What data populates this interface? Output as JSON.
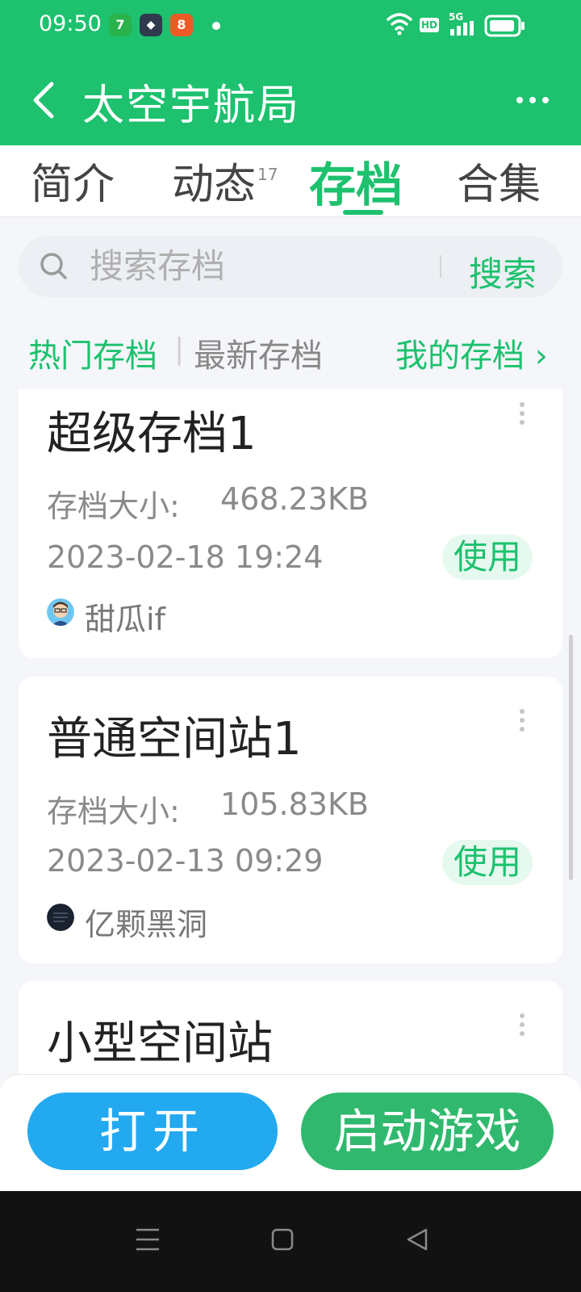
{
  "status_bar": {
    "time": "09:50",
    "apps": [
      {
        "icon": "green-app-icon",
        "glyph": "7",
        "color": "#29b34a"
      },
      {
        "icon": "dark-app-icon",
        "glyph": "◆",
        "color": "#2f3a4f"
      },
      {
        "icon": "orange-app-icon",
        "glyph": "8",
        "color": "#ee5a24"
      }
    ],
    "hd_label": "HD",
    "network_label": "5G"
  },
  "header": {
    "title": "太空宇航局",
    "back_icon": "back-arrow-icon",
    "more_icon": "more-dots-icon"
  },
  "tabs": [
    {
      "label": "简介",
      "badge": ""
    },
    {
      "label": "动态",
      "badge": "17"
    },
    {
      "label": "存档",
      "badge": "",
      "active": true
    },
    {
      "label": "合集",
      "badge": ""
    }
  ],
  "search": {
    "placeholder": "搜索存档",
    "button_label": "搜索"
  },
  "filters": {
    "hot": "热门存档",
    "separator": "|",
    "newest": "最新存档",
    "mine": "我的存档 ›"
  },
  "cards": [
    {
      "title": "超级存档1",
      "size_label": "存档大小:",
      "size": "468.23KB",
      "date": "2023-02-18 19:24",
      "use_label": "使用",
      "author": "甜瓜if"
    },
    {
      "title": "普通空间站1",
      "size_label": "存档大小:",
      "size": "105.83KB",
      "date": "2023-02-13 09:29",
      "use_label": "使用",
      "author": "亿颗黑洞"
    },
    {
      "title": "小型空间站"
    }
  ],
  "actions": {
    "open_label": "打开",
    "start_label": "启动游戏"
  },
  "colors": {
    "accent": "#1dc16e",
    "open_button": "#22a9f0",
    "start_button": "#30b96e"
  }
}
